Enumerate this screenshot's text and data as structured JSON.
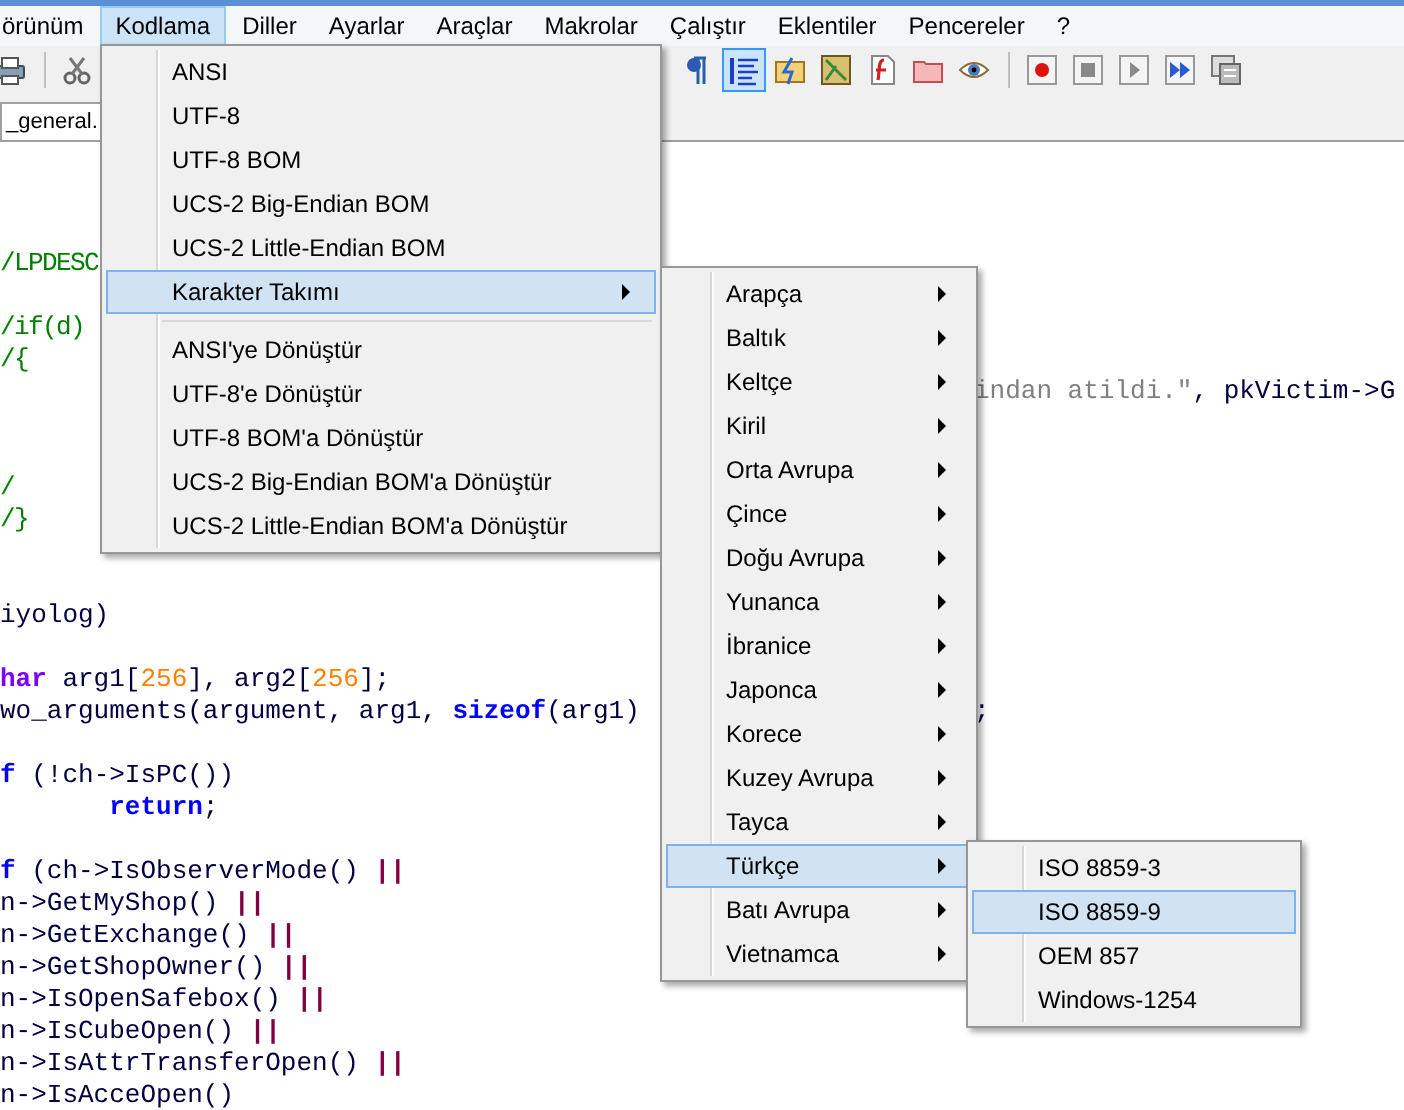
{
  "menu_bar": [
    {
      "label": "örünüm",
      "selected": false
    },
    {
      "label": "Kodlama",
      "selected": true
    },
    {
      "label": "Diller",
      "selected": false
    },
    {
      "label": "Ayarlar",
      "selected": false
    },
    {
      "label": "Araçlar",
      "selected": false
    },
    {
      "label": "Makrolar",
      "selected": false
    },
    {
      "label": "Çalıştır",
      "selected": false
    },
    {
      "label": "Eklentiler",
      "selected": false
    },
    {
      "label": "Pencereler",
      "selected": false
    },
    {
      "label": "?",
      "selected": false
    }
  ],
  "toolbar": {
    "buttons": [
      {
        "pressed": false
      },
      {
        "pressed": true
      },
      {
        "pressed": false
      },
      {
        "pressed": false
      },
      {
        "pressed": false
      },
      {
        "pressed": false
      },
      {
        "pressed": false
      },
      {
        "pressed": false
      },
      {
        "pressed": false
      },
      {
        "pressed": false
      },
      {
        "pressed": false
      },
      {
        "pressed": false
      }
    ]
  },
  "tabs": [
    {
      "label": "_general.",
      "selected": true
    }
  ],
  "editor": {
    "lines": [
      {
        "segments": [
          {
            "kind": "comment",
            "text": "/LPDESC"
          }
        ]
      },
      {
        "segments": [
          {
            "kind": "comment",
            "text": "/if(d)"
          }
        ]
      },
      {
        "segments": [
          {
            "kind": "comment",
            "text": "/{"
          }
        ]
      },
      {
        "tail": [
          {
            "kind": "string",
            "text": "indan atildi.\""
          },
          {
            "kind": "plain",
            "text": ", pkVictim->G"
          }
        ]
      },
      {
        "segments": [
          {
            "kind": "comment",
            "text": "/"
          }
        ]
      },
      {
        "segments": [
          {
            "kind": "comment",
            "text": "/}"
          }
        ]
      },
      {
        "segments": [
          {
            "kind": "plain",
            "text": "iyolog)"
          }
        ]
      },
      {
        "segments": [
          {
            "kind": "type",
            "text": "har"
          },
          {
            "kind": "plain",
            "text": " arg1["
          },
          {
            "kind": "number",
            "text": "256"
          },
          {
            "kind": "plain",
            "text": "], arg2["
          },
          {
            "kind": "number",
            "text": "256"
          },
          {
            "kind": "plain",
            "text": "];"
          }
        ]
      },
      {
        "segments": [
          {
            "kind": "plain",
            "text": "wo_arguments(argument, arg1, "
          },
          {
            "kind": "keyword",
            "text": "sizeof"
          },
          {
            "kind": "plain",
            "text": "(arg1)"
          }
        ],
        "tail": [
          {
            "kind": "plain",
            "text": ";"
          }
        ]
      },
      {
        "segments": [
          {
            "kind": "keyword",
            "text": "f"
          },
          {
            "kind": "plain",
            "text": " (!ch->IsPC())"
          }
        ]
      },
      {
        "segments": [
          {
            "kind": "keyword",
            "text": "       return"
          },
          {
            "kind": "plain",
            "text": ";"
          }
        ]
      },
      {
        "segments": [
          {
            "kind": "keyword",
            "text": "f"
          },
          {
            "kind": "plain",
            "text": " (ch->IsObserverMode() "
          },
          {
            "kind": "operator",
            "text": "||"
          }
        ]
      },
      {
        "segments": [
          {
            "kind": "plain",
            "text": "n->GetMyShop() "
          },
          {
            "kind": "operator",
            "text": "||"
          }
        ]
      },
      {
        "segments": [
          {
            "kind": "plain",
            "text": "n->GetExchange() "
          },
          {
            "kind": "operator",
            "text": "||"
          }
        ]
      },
      {
        "segments": [
          {
            "kind": "plain",
            "text": "n->GetShopOwner() "
          },
          {
            "kind": "operator",
            "text": "||"
          }
        ]
      },
      {
        "segments": [
          {
            "kind": "plain",
            "text": "n->IsOpenSafebox() "
          },
          {
            "kind": "operator",
            "text": "||"
          }
        ]
      },
      {
        "segments": [
          {
            "kind": "plain",
            "text": "n->IsCubeOpen() "
          },
          {
            "kind": "operator",
            "text": "||"
          }
        ]
      },
      {
        "segments": [
          {
            "kind": "plain",
            "text": "n->IsAttrTransferOpen() "
          },
          {
            "kind": "operator",
            "text": "||"
          }
        ]
      },
      {
        "segments": [
          {
            "kind": "plain",
            "text": "n->IsAcceOpen()"
          }
        ]
      }
    ]
  },
  "menus": [
    {
      "items": [
        {
          "kind": "item",
          "label": "ANSI",
          "selected": false,
          "submenu": false
        },
        {
          "kind": "item",
          "label": "UTF-8",
          "selected": false,
          "submenu": false
        },
        {
          "kind": "item",
          "label": "UTF-8 BOM",
          "selected": false,
          "submenu": false
        },
        {
          "kind": "item",
          "label": "UCS-2 Big-Endian BOM",
          "selected": false,
          "submenu": false
        },
        {
          "kind": "item",
          "label": "UCS-2 Little-Endian BOM",
          "selected": false,
          "submenu": false
        },
        {
          "kind": "item",
          "label": "Karakter Takımı",
          "selected": true,
          "submenu": true
        },
        {
          "kind": "separator"
        },
        {
          "kind": "item",
          "label": "ANSI'ye Dönüştür",
          "selected": false,
          "submenu": false
        },
        {
          "kind": "item",
          "label": "UTF-8'e Dönüştür",
          "selected": false,
          "submenu": false
        },
        {
          "kind": "item",
          "label": "UTF-8 BOM'a Dönüştür",
          "selected": false,
          "submenu": false
        },
        {
          "kind": "item",
          "label": "UCS-2 Big-Endian BOM'a Dönüştür",
          "selected": false,
          "submenu": false
        },
        {
          "kind": "item",
          "label": "UCS-2 Little-Endian BOM'a Dönüştür",
          "selected": false,
          "submenu": false
        }
      ]
    },
    {
      "items": [
        {
          "kind": "item",
          "label": "Arapça",
          "selected": false,
          "submenu": true
        },
        {
          "kind": "item",
          "label": "Baltık",
          "selected": false,
          "submenu": true
        },
        {
          "kind": "item",
          "label": "Keltçe",
          "selected": false,
          "submenu": true
        },
        {
          "kind": "item",
          "label": "Kiril",
          "selected": false,
          "submenu": true
        },
        {
          "kind": "item",
          "label": "Orta Avrupa",
          "selected": false,
          "submenu": true
        },
        {
          "kind": "item",
          "label": "Çince",
          "selected": false,
          "submenu": true
        },
        {
          "kind": "item",
          "label": "Doğu Avrupa",
          "selected": false,
          "submenu": true
        },
        {
          "kind": "item",
          "label": "Yunanca",
          "selected": false,
          "submenu": true
        },
        {
          "kind": "item",
          "label": "İbranice",
          "selected": false,
          "submenu": true
        },
        {
          "kind": "item",
          "label": "Japonca",
          "selected": false,
          "submenu": true
        },
        {
          "kind": "item",
          "label": "Korece",
          "selected": false,
          "submenu": true
        },
        {
          "kind": "item",
          "label": "Kuzey Avrupa",
          "selected": false,
          "submenu": true
        },
        {
          "kind": "item",
          "label": "Tayca",
          "selected": false,
          "submenu": true
        },
        {
          "kind": "item",
          "label": "Türkçe",
          "selected": true,
          "submenu": true
        },
        {
          "kind": "item",
          "label": "Batı Avrupa",
          "selected": false,
          "submenu": true
        },
        {
          "kind": "item",
          "label": "Vietnamca",
          "selected": false,
          "submenu": true
        }
      ]
    },
    {
      "items": [
        {
          "kind": "item",
          "label": "ISO 8859-3",
          "selected": false,
          "submenu": false
        },
        {
          "kind": "item",
          "label": "ISO 8859-9",
          "selected": true,
          "submenu": false
        },
        {
          "kind": "item",
          "label": "OEM 857",
          "selected": false,
          "submenu": false
        },
        {
          "kind": "item",
          "label": "Windows-1254",
          "selected": false,
          "submenu": false
        }
      ]
    }
  ]
}
